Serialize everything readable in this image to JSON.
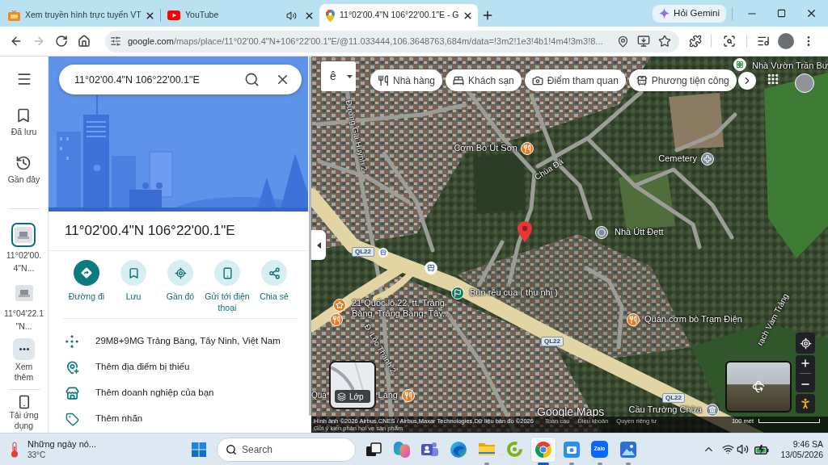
{
  "browser": {
    "tabs": [
      {
        "title": "Xem truyền hình trực tuyến VT",
        "kind": "tv",
        "selected": false,
        "audio": false
      },
      {
        "title": "YouTube",
        "kind": "video",
        "selected": false,
        "audio": true
      },
      {
        "title": "11°02'00.4\"N 106°22'00.1\"E - G",
        "kind": "maps",
        "selected": true,
        "audio": false
      }
    ],
    "gemini_button": "Hỏi Gemini",
    "nav": [
      {
        "kind": "back",
        "disabled": false
      },
      {
        "kind": "forward",
        "disabled": true
      },
      {
        "kind": "reload",
        "disabled": false
      },
      {
        "kind": "home",
        "disabled": false
      }
    ],
    "address": {
      "host": "google.com",
      "path": "/maps/place/11°02'00.4\"N+106°22'00.1\"E/@11.033444,106.3648763,684m/data=!3m2!1e3!4b1!4m4!3m3!8..."
    }
  },
  "rail": {
    "items": [
      {
        "label": "Đã lưu",
        "kind": "saved"
      },
      {
        "label": "Gần đây",
        "kind": "recent"
      }
    ],
    "recent_places": [
      {
        "lines": [
          "11°02'00.",
          "4\"N..."
        ],
        "selected": true
      },
      {
        "lines": [
          "11°04'22.1",
          "\"N..."
        ],
        "selected": false
      }
    ],
    "more": "Xem thêm",
    "get_app": "Tải ứng dụng"
  },
  "panel": {
    "search": {
      "value": "11°02'00.4\"N 106°22'00.1\"E"
    },
    "title": "11°02'00.4\"N 106°22'00.1\"E",
    "actions": [
      {
        "label": "Đường đi",
        "kind": "directions",
        "primary": true
      },
      {
        "label": "Lưu",
        "kind": "save",
        "primary": false
      },
      {
        "label": "Gần đó",
        "kind": "nearby",
        "primary": false
      },
      {
        "label": "Gửi tới điện thoại",
        "kind": "send",
        "primary": false
      },
      {
        "label": "Chia sẻ",
        "kind": "share",
        "primary": false
      }
    ],
    "details": [
      {
        "text": "29M8+9MG Trảng Bàng, Tây Ninh, Việt Nam",
        "kind": "plus_code"
      },
      {
        "text": "Thêm địa điểm bị thiếu",
        "kind": "add_place"
      },
      {
        "text": "Thêm doanh nghiệp của bạn",
        "kind": "add_business"
      },
      {
        "text": "Thêm nhãn",
        "kind": "label"
      }
    ]
  },
  "map": {
    "input_indicator": "ê",
    "chips": [
      {
        "label": "Nhà hàng",
        "kind": "restaurant"
      },
      {
        "label": "Khách sạn",
        "kind": "hotel"
      },
      {
        "label": "Điểm tham quan",
        "kind": "attraction"
      },
      {
        "label": "Phương tiện công",
        "kind": "transit"
      }
    ],
    "places": [
      {
        "name": "Nhà Vườn Trần Bư",
        "kind": "garden"
      },
      {
        "name": "Cơm Bò Út Sơn",
        "kind": "restaurant"
      },
      {
        "name": "Cemetery",
        "kind": "cemetery"
      },
      {
        "name": "Nhà Útt Đẹtt",
        "kind": "place"
      },
      {
        "name": "Bún rêu cua ( thu nhi )",
        "kind": "flag"
      },
      {
        "name": "21 Quốc lộ 22, tt. Trảng Bàng, Trảng Bàng, Tây...",
        "kind": "starred"
      },
      {
        "name": "Quán cơm bò Trạm Điện",
        "kind": "restaurant"
      },
      {
        "name": "Quá",
        "kind": "text"
      },
      {
        "name": "Láng",
        "kind": "restaurant"
      },
      {
        "name": "Cầu Trường Chừa",
        "kind": "bridge"
      }
    ],
    "street_labels": [
      "Đường Gia Huỳnh 2",
      "Chùa Đá",
      "Đ. Lộc Thành 2",
      "rạch Vàm Trảng"
    ],
    "route_shields": [
      "QL22",
      "QL22",
      "QL22"
    ],
    "logo": "Google Maps",
    "layers_button": "Lớp",
    "footer": {
      "attribution": "Hình ảnh ©2026 Airbus,CNES / Airbus,Maxar Technologies,Dữ liệu bản đồ ©2026",
      "links": [
        "Toàn cầu",
        "Điều khoản",
        "Quyền riêng tư"
      ],
      "scale": "100 mét",
      "feedback": "Gửi ý kiến phản hồi về sản phẩm"
    }
  },
  "taskbar": {
    "weather": {
      "headline": "Những ngày nó...",
      "temperature": "33°C"
    },
    "search": {
      "placeholder": "Search"
    },
    "apps": [
      {
        "kind": "task_view",
        "running": false,
        "selected": false
      },
      {
        "kind": "assistant",
        "running": false,
        "selected": false
      },
      {
        "kind": "team_chat",
        "running": false,
        "selected": false
      },
      {
        "kind": "edge_browser",
        "running": false,
        "selected": false
      },
      {
        "kind": "folder",
        "running": true,
        "selected": false
      },
      {
        "kind": "ring_app",
        "running": false,
        "selected": false
      },
      {
        "kind": "browser",
        "running": true,
        "selected": true
      },
      {
        "kind": "camera_app",
        "running": true,
        "selected": false
      },
      {
        "kind": "chat_app",
        "label": "Zalo",
        "running": true,
        "selected": false
      },
      {
        "kind": "photos",
        "running": true,
        "selected": false
      }
    ],
    "clock": {
      "time": "9:46 SA",
      "date": "13/05/2026"
    }
  }
}
